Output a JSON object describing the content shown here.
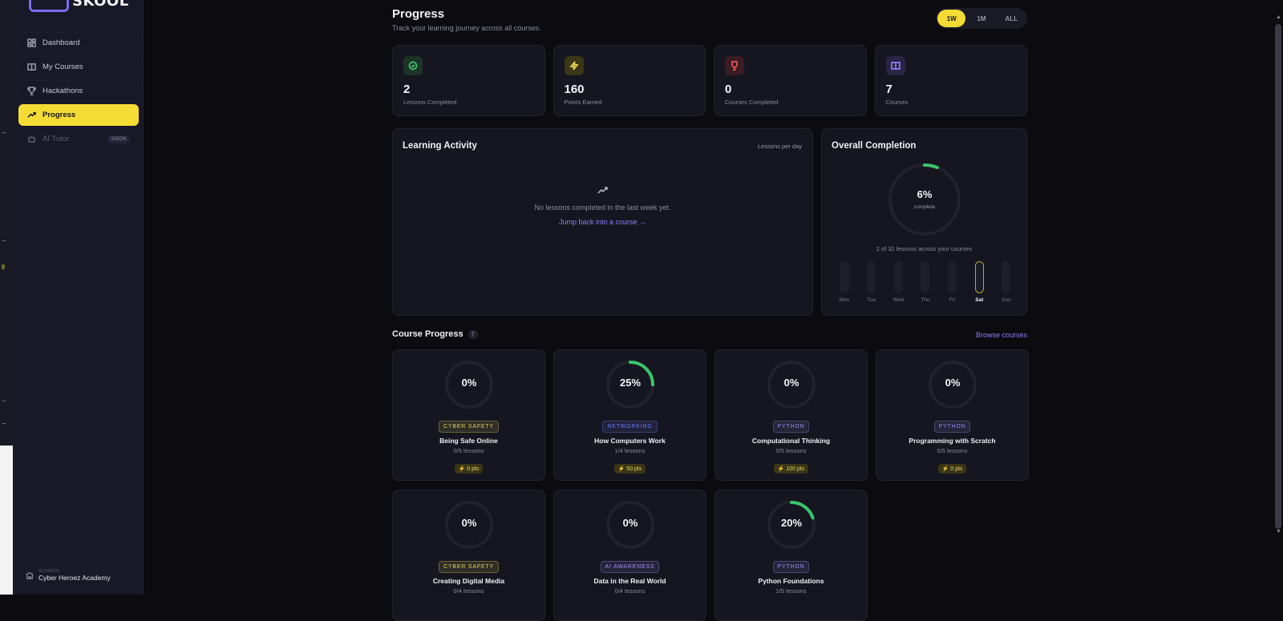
{
  "brand": {
    "logo_text": "SKOOL"
  },
  "sidebar": {
    "items": [
      {
        "label": "Dashboard",
        "icon": "dashboard-icon"
      },
      {
        "label": "My Courses",
        "icon": "book-icon"
      },
      {
        "label": "Hackathons",
        "icon": "trophy-icon"
      },
      {
        "label": "Progress",
        "icon": "trending-up-icon",
        "active": true
      },
      {
        "label": "AI Tutor",
        "icon": "robot-icon",
        "badge": "SOON"
      }
    ],
    "school_caption": "SCHOOL",
    "school_name": "Cyber Heroez Academy"
  },
  "header": {
    "title": "Progress",
    "subtitle": "Track your learning journey across all courses.",
    "ranges": [
      "1W",
      "1M",
      "ALL"
    ],
    "active_range": "1W"
  },
  "stats": [
    {
      "value": "2",
      "label": "Lessons Completed",
      "icon": "check-circle-icon",
      "color": "#39c56b"
    },
    {
      "value": "160",
      "label": "Points Earned",
      "icon": "lightning-icon",
      "color": "#e6d35a"
    },
    {
      "value": "0",
      "label": "Courses Completed",
      "icon": "trophy-icon",
      "color": "#e0555a"
    },
    {
      "value": "7",
      "label": "Courses",
      "icon": "book-icon",
      "color": "#8e7df5"
    }
  ],
  "activity": {
    "title": "Learning Activity",
    "hint": "Lessons per day",
    "empty_text": "No lessons completed in the last week yet.",
    "cta": "Jump back into a course →"
  },
  "overall": {
    "title": "Overall Completion",
    "percent_label": "6%",
    "percent": 6,
    "caption": "complete",
    "summary": "2 of 32 lessons across your courses",
    "days": [
      "Mon",
      "Tue",
      "Wed",
      "Thu",
      "Fri",
      "Sat",
      "Sun"
    ],
    "today": "Sat"
  },
  "course_progress": {
    "title": "Course Progress",
    "count": "7",
    "browse": "Browse courses",
    "courses": [
      {
        "pct_label": "0%",
        "percent": 0,
        "tag": "CYBER SAFETY",
        "name": "Being Safe Online",
        "lessons": "0/5 lessons",
        "pts": "0 pts"
      },
      {
        "pct_label": "25%",
        "percent": 25,
        "tag": "NETWORKING",
        "name": "How Computers Work",
        "lessons": "1/4 lessons",
        "pts": "50 pts"
      },
      {
        "pct_label": "0%",
        "percent": 0,
        "tag": "PYTHON",
        "name": "Computational Thinking",
        "lessons": "0/5 lessons",
        "pts": "100 pts"
      },
      {
        "pct_label": "0%",
        "percent": 0,
        "tag": "PYTHON",
        "name": "Programming with Scratch",
        "lessons": "0/5 lessons",
        "pts": "0 pts"
      },
      {
        "pct_label": "0%",
        "percent": 0,
        "tag": "CYBER SAFETY",
        "name": "Creating Digital Media",
        "lessons": "0/4 lessons"
      },
      {
        "pct_label": "0%",
        "percent": 0,
        "tag": "AI AWARENESS",
        "name": "Data in the Real World",
        "lessons": "0/4 lessons"
      },
      {
        "pct_label": "20%",
        "percent": 20,
        "tag": "PYTHON",
        "name": "Python Foundations",
        "lessons": "1/5 lessons"
      }
    ]
  },
  "colors": {
    "accent": "#f5dc35",
    "link": "#8e7df5",
    "progress": "#39c56b",
    "tag_cyber_safety": "#e6d35a",
    "tag_networking": "#6f7cf5",
    "tag_python": "#9a8ef0",
    "tag_ai_awareness": "#a08cf5"
  }
}
